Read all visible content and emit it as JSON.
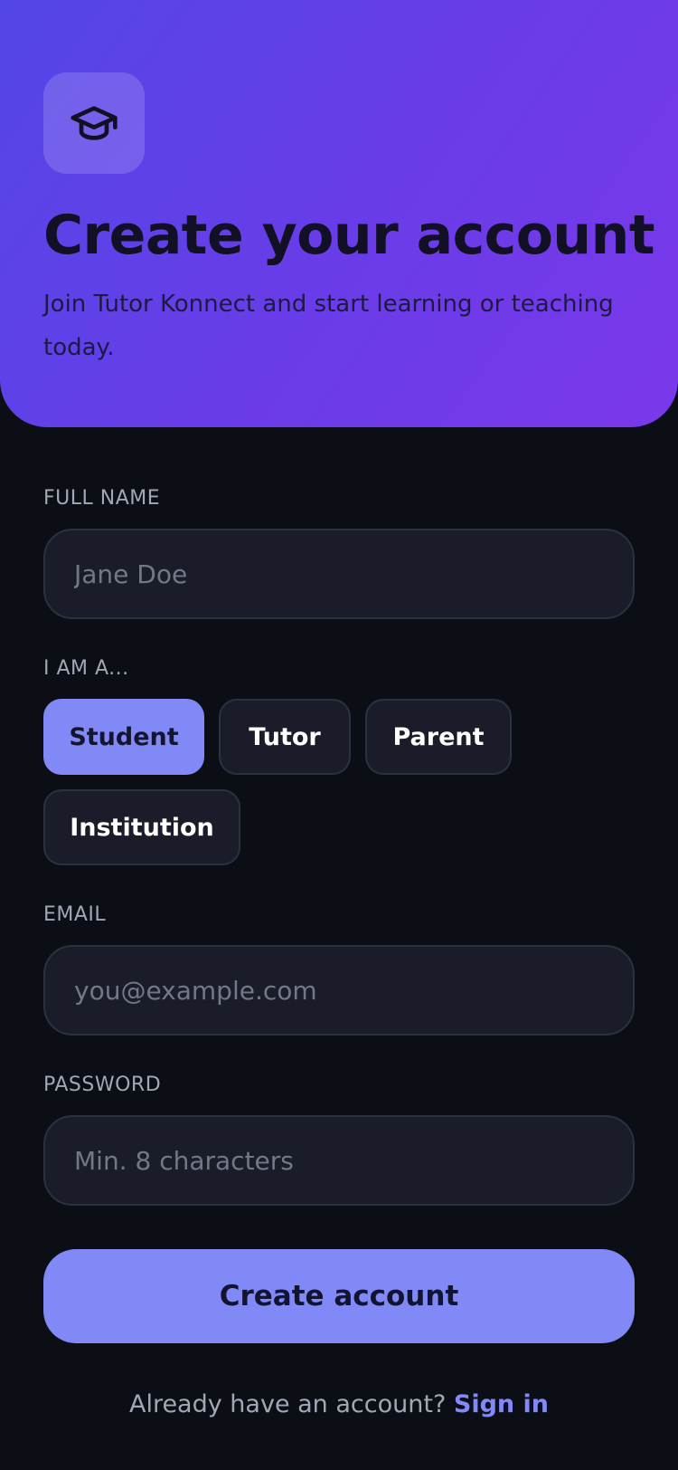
{
  "header": {
    "logo_icon": "graduation-cap-icon",
    "title": "Create your account",
    "subtitle": "Join Tutor Konnect and start learning or teaching today."
  },
  "form": {
    "full_name": {
      "label": "FULL NAME",
      "placeholder": "Jane Doe",
      "value": ""
    },
    "role": {
      "label": "I AM A...",
      "options": [
        "Student",
        "Tutor",
        "Parent",
        "Institution"
      ],
      "selected": "Student"
    },
    "email": {
      "label": "EMAIL",
      "placeholder": "you@example.com",
      "value": ""
    },
    "password": {
      "label": "PASSWORD",
      "placeholder": "Min. 8 characters",
      "value": ""
    },
    "submit_label": "Create account"
  },
  "footer": {
    "prompt": "Already have an account?",
    "link_label": "Sign in"
  },
  "colors": {
    "gradient_start": "#5346e6",
    "gradient_end": "#7a38ea",
    "accent": "#8189f7",
    "background": "#0c0e16",
    "field_bg": "#1a1d29"
  }
}
